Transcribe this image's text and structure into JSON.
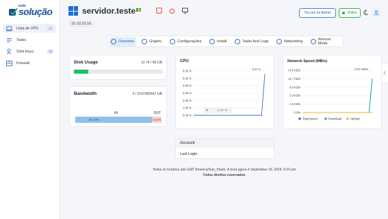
{
  "brand": {
    "small": "todo",
    "big": "solução",
    "tagline": ""
  },
  "nav": [
    {
      "label": "Lista de VPS",
      "count": "2",
      "icon": "laptop-icon"
    },
    {
      "label": "Tasks",
      "count": "",
      "icon": "tasks-icon"
    },
    {
      "label": "SSH Keys",
      "count": "0",
      "icon": "key-user-icon"
    },
    {
      "label": "Firewall",
      "count": "",
      "icon": "firewall-icon"
    }
  ],
  "server": {
    "name": "servidor.teste",
    "ip": "10.10.10.10"
  },
  "header": {
    "admin_label": "You are an Admin",
    "status_label": "Online"
  },
  "tabs": [
    "Overview",
    "Graphs",
    "Configurações",
    "Install",
    "Tasks And Logs",
    "Networking",
    "Rescue Mode"
  ],
  "disk": {
    "title": "Disk Usage",
    "value": "12.74 / 80 GB",
    "fraction": 0.16
  },
  "bandwidth": {
    "title": "Bandwidth",
    "value": "0 / 2147483647 GB",
    "in_label": "IN",
    "out_label": "OUT",
    "in_pct": "91.67%",
    "out_pct": "8.33%",
    "in_fraction": 0.9167
  },
  "cpu": {
    "title": "CPU",
    "current": "5.6 %",
    "tooltip": "0.00 %"
  },
  "network": {
    "title": "Network Speed (MB/s)",
    "current": "0.01 MB/s"
  },
  "account": {
    "title": "Account",
    "last_login": "Last Login"
  },
  "footer": {
    "line1": "Todos os horários são GMT America/Sao_Paulo. A hora agora é September 19, 2024, 9:10 am",
    "line2": "Todos direitos reservados"
  },
  "chart_data": [
    {
      "type": "line",
      "title": "CPU",
      "xlabel": "",
      "ylabel": "",
      "yticks": [
        "0.00 %",
        "1.00 %",
        "2.00 %",
        "3.00 %",
        "4.00 %",
        "5.00 %",
        "6.00 %"
      ],
      "ylim": [
        0,
        6
      ],
      "series": [
        {
          "values": [
            0,
            0,
            0,
            0,
            0,
            0,
            0,
            0,
            0,
            0,
            0,
            0,
            0,
            0,
            0,
            0,
            0,
            0,
            0,
            0,
            0,
            0,
            5.6
          ]
        }
      ]
    },
    {
      "type": "line",
      "title": "Network Speed (MB/s)",
      "xlabel": "",
      "ylabel": "",
      "yticks": [
        "0 B/s",
        "2.9 KB/s",
        "5.9 KB/s",
        "8.8 KB/s",
        "11.7 KB/s",
        "14.6 KB/s"
      ],
      "ylim": [
        0,
        14.6
      ],
      "series": [
        {
          "name": "Total speed",
          "color": "#3a66c4",
          "values": [
            0,
            0,
            0,
            0,
            0,
            0,
            0,
            0,
            0,
            0,
            0,
            0,
            0,
            0,
            0,
            0,
            0,
            0,
            0,
            0,
            0,
            0,
            11.7
          ]
        },
        {
          "name": "Download",
          "color": "#19b394",
          "values": [
            0,
            0,
            0,
            0,
            0,
            0,
            0,
            0,
            0,
            0,
            0,
            0,
            0,
            0,
            0,
            0,
            0,
            0,
            0,
            0,
            0,
            0,
            11.5
          ]
        },
        {
          "name": "Upload",
          "color": "#e8b52a",
          "values": [
            0,
            0,
            0,
            0,
            0,
            0,
            0,
            0,
            0,
            0,
            0,
            0,
            0,
            0,
            0,
            0,
            0,
            0,
            0,
            0,
            0,
            0,
            0.1
          ]
        }
      ],
      "legend": "bottom"
    }
  ]
}
